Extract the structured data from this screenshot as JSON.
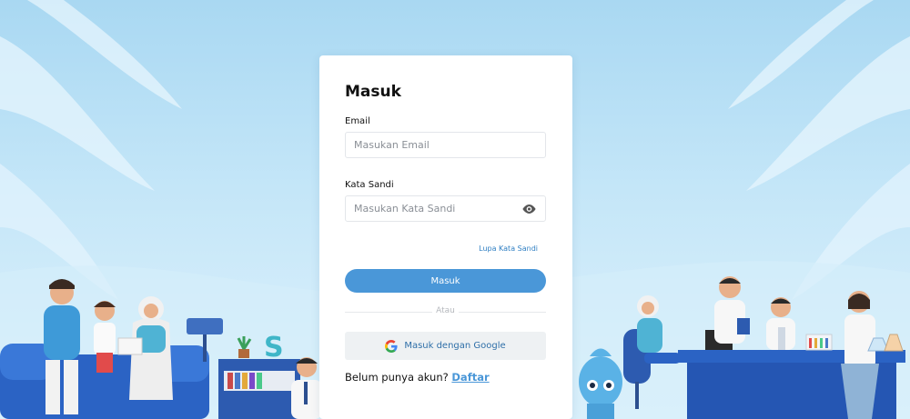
{
  "login": {
    "title": "Masuk",
    "email_label": "Email",
    "email_placeholder": "Masukan Email",
    "email_value": "",
    "password_label": "Kata Sandi",
    "password_placeholder": "Masukan Kata Sandi",
    "password_value": "",
    "forgot_label": "Lupa Kata Sandi",
    "submit_label": "Masuk",
    "divider_label": "Atau",
    "google_label": "Masuk dengan Google",
    "signup_prompt": "Belum punya akun?",
    "signup_link": "Daftar"
  },
  "icons": {
    "password_toggle": "eye-icon",
    "google": "google-icon"
  },
  "colors": {
    "accent": "#4a97d8",
    "link": "#2f7fc3",
    "background": "#b7dff4"
  }
}
